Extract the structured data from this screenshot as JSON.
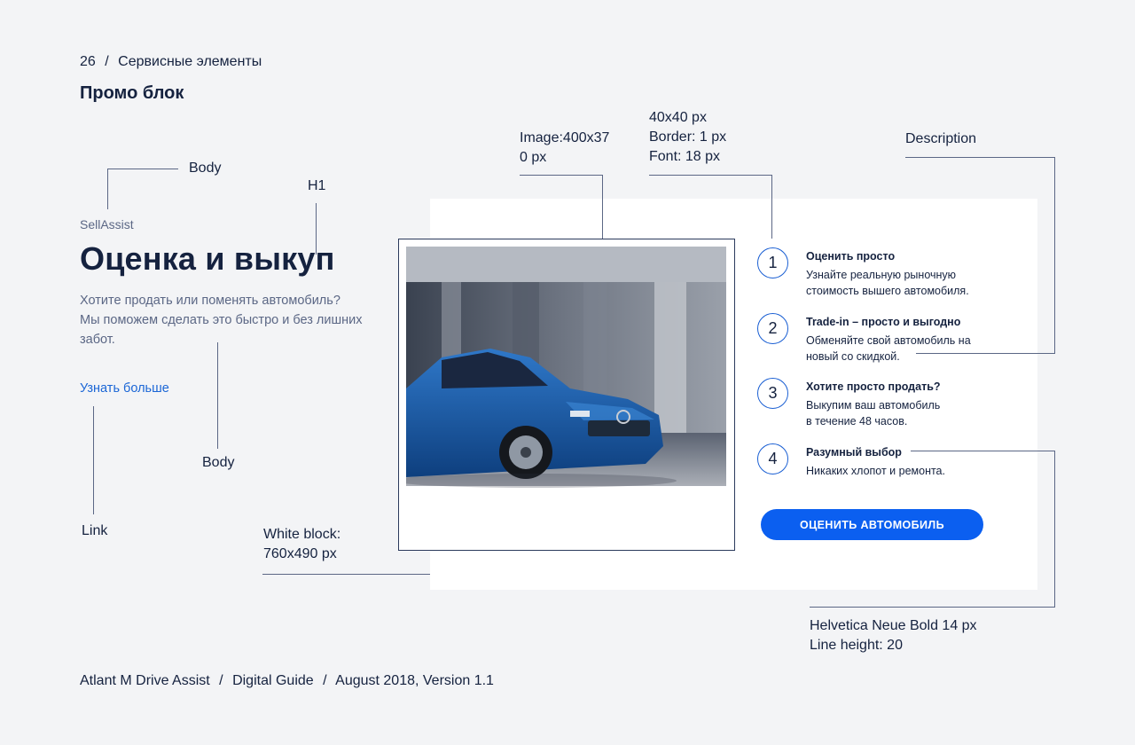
{
  "header": {
    "page_number": "26",
    "separator": "/",
    "section": "Сервисные элементы",
    "title": "Промо блок"
  },
  "annotations": {
    "body_top": "Body",
    "h1": "H1",
    "image": "Image:400x37\n0 px",
    "circle": "40x40 px\nBorder: 1 px\nFont: 18 px",
    "description": "Description",
    "body_bottom": "Body",
    "link": "Link",
    "white_block": "White block:\n760x490 px",
    "button_font": "Helvetica Neue Bold 14 px\nLine height: 20"
  },
  "promo": {
    "brand": "SellAssist",
    "headline": "Оценка и выкуп",
    "lead": "Хотите продать или поменять автомобиль? Мы поможем сделать это быстро и без лишних забот.",
    "link": "Узнать больше",
    "steps": [
      {
        "number": "1",
        "title": "Оценить просто",
        "desc": "Узнайте реальную рыночную\nстоимость вышего автомобиля."
      },
      {
        "number": "2",
        "title": "Trade-in – просто и выгодно",
        "desc": "Обменяйте свой автомобиль на\nновый со скидкой."
      },
      {
        "number": "3",
        "title": "Хотите просто продать?",
        "desc": "Выкупим ваш автомобиль\nв течение 48 часов."
      },
      {
        "number": "4",
        "title": "Разумный выбор",
        "desc": "Никаких хлопот и ремонта."
      }
    ],
    "cta": "ОЦЕНИТЬ АВТОМОБИЛЬ"
  },
  "footer": {
    "product": "Atlant M Drive Assist",
    "separator": "/",
    "guide": "Digital Guide",
    "version": "August 2018, Version 1.1"
  },
  "colors": {
    "background": "#f3f4f6",
    "text_dark": "#15223f",
    "text_muted": "#5b6785",
    "accent_blue": "#0b5ff0",
    "link_blue": "#1b66d6",
    "car_blue": "#1d5fa8"
  }
}
